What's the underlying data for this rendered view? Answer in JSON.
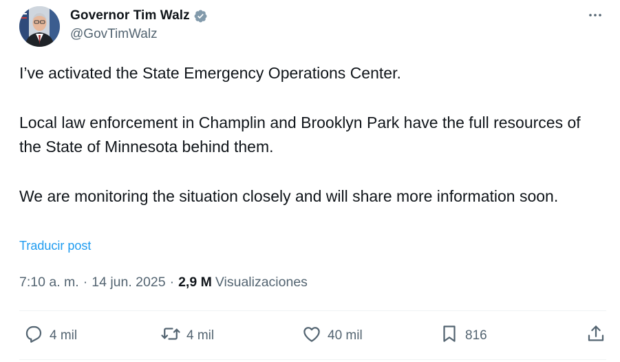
{
  "author": {
    "display_name": "Governor Tim Walz",
    "handle": "@GovTimWalz",
    "verified": true
  },
  "post": {
    "paragraphs": [
      "I’ve activated the State Emergency Operations Center.",
      "Local law enforcement in Champlin and Brooklyn Park have the full resources of the State of Minnesota behind them.",
      "We are monitoring the situation closely and will share more information soon."
    ],
    "translate_label": "Traducir post",
    "time": "7:10 a. m.",
    "date": "14 jun. 2025",
    "views_count": "2,9 M",
    "views_label": "Visualizaciones"
  },
  "actions": {
    "replies": "4 mil",
    "reposts": "4 mil",
    "likes": "40 mil",
    "bookmarks": "816"
  },
  "icons": {
    "verified": "verified-badge-icon",
    "more": "more-horizontal-icon",
    "reply": "reply-icon",
    "repost": "repost-icon",
    "like": "heart-icon",
    "bookmark": "bookmark-icon",
    "share": "share-icon"
  },
  "colors": {
    "link": "#1d9bf0",
    "secondary_text": "#536471",
    "primary_text": "#0f1419",
    "divider": "#eff3f4"
  }
}
